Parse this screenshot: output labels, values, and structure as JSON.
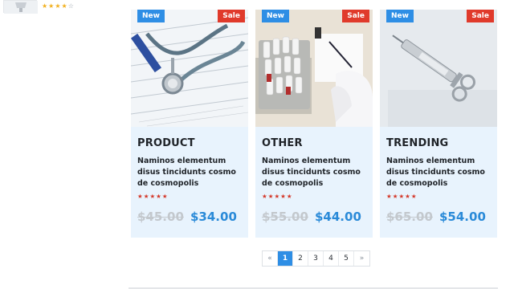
{
  "sidebar": {
    "rating_on": "★★★★",
    "rating_off": "☆"
  },
  "products": [
    {
      "badge_new": "New",
      "badge_sale": "Sale",
      "category": "PRODUCT",
      "description": "Naminos elementum disus tincidunts cosmo de cosmopolis",
      "rating": "★★★★★",
      "old_price": "$45.00",
      "price": "$34.00",
      "image_icon": "stethoscope-image"
    },
    {
      "badge_new": "New",
      "badge_sale": "Sale",
      "category": "OTHER",
      "description": "Naminos elementum disus tincidunts cosmo de cosmopolis",
      "rating": "★★★★★",
      "old_price": "$55.00",
      "price": "$44.00",
      "image_icon": "lab-tubes-image"
    },
    {
      "badge_new": "New",
      "badge_sale": "Sale",
      "category": "TRENDING",
      "description": "Naminos elementum disus tincidunts cosmo de cosmopolis",
      "rating": "★★★★★",
      "old_price": "$65.00",
      "price": "$54.00",
      "image_icon": "syringe-image"
    }
  ],
  "pagination": {
    "prev": "«",
    "pages": [
      "1",
      "2",
      "3",
      "4",
      "5"
    ],
    "next": "»",
    "active_page": "1"
  },
  "colors": {
    "accent": "#2e8ee5",
    "sale": "#e03a2b",
    "card_bg": "#e8f3fd",
    "price": "#2a8ad8"
  }
}
